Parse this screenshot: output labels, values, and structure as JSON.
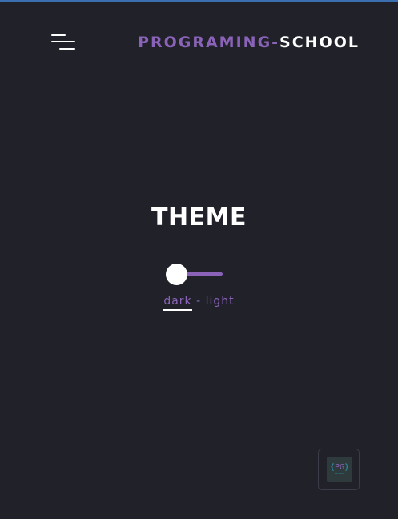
{
  "header": {
    "brand_part1": "PROGRAMING-",
    "brand_part2": "SCHOOL",
    "menu_icon": "hamburger-menu-icon"
  },
  "theme": {
    "title": "THEME",
    "toggle_state": "dark",
    "label_dark": "dark",
    "separator": " - ",
    "label_light": "light"
  },
  "logo": {
    "brace_open": "{",
    "initials": "PG",
    "brace_close": "}",
    "subtitle": "SCHOOL"
  },
  "colors": {
    "background": "#21212a",
    "accent": "#8a63b8",
    "text": "#ffffff",
    "top_border": "#3a6fb0"
  }
}
